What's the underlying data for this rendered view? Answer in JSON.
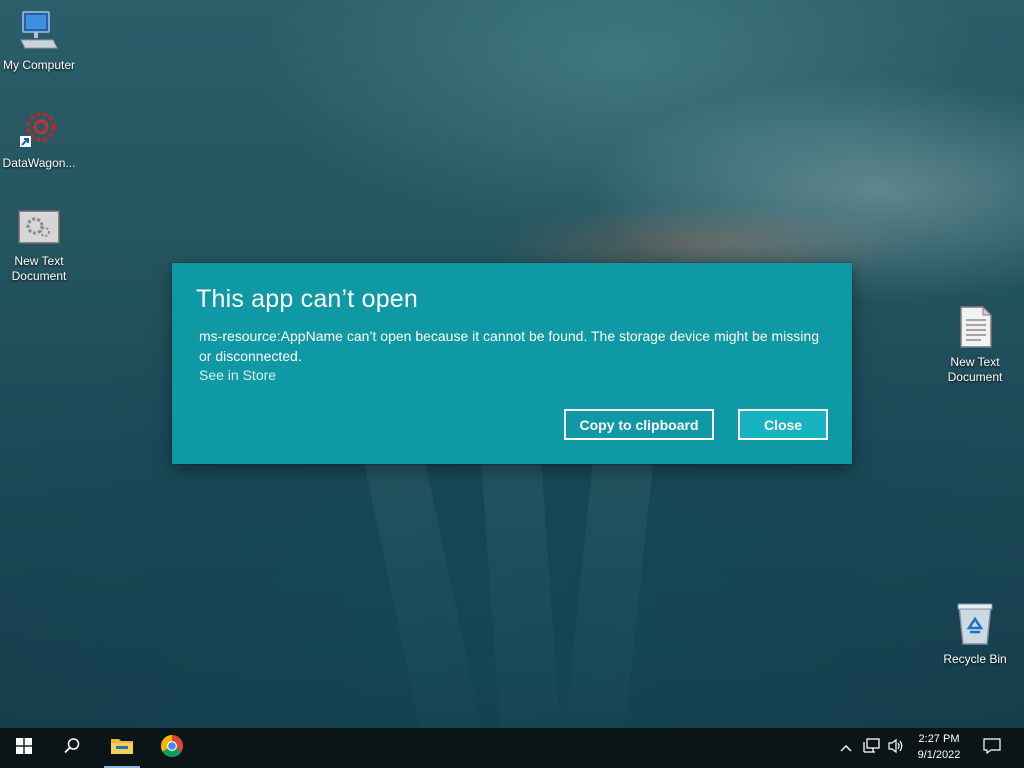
{
  "desktop": {
    "icons_left": [
      {
        "label": "My Computer"
      },
      {
        "label": "DataWagon..."
      },
      {
        "label": "New Text Document"
      }
    ],
    "icons_right": [
      {
        "label": "New Text Document"
      },
      {
        "label": "Recycle Bin"
      }
    ]
  },
  "dialog": {
    "title": "This app can’t open",
    "message": "ms-resource:AppName can’t open because it cannot be found. The storage device might be missing or disconnected.",
    "link": "See in Store",
    "copy_button": "Copy to clipboard",
    "close_button": "Close",
    "background_color": "#0f99a4",
    "primary_button_color": "#17b3c0"
  },
  "taskbar": {
    "start": "start-icon",
    "search": "search-icon",
    "pinned": [
      "file-explorer-icon",
      "chrome-icon"
    ],
    "tray": {
      "time": "2:27 PM",
      "date": "9/1/2022"
    }
  }
}
